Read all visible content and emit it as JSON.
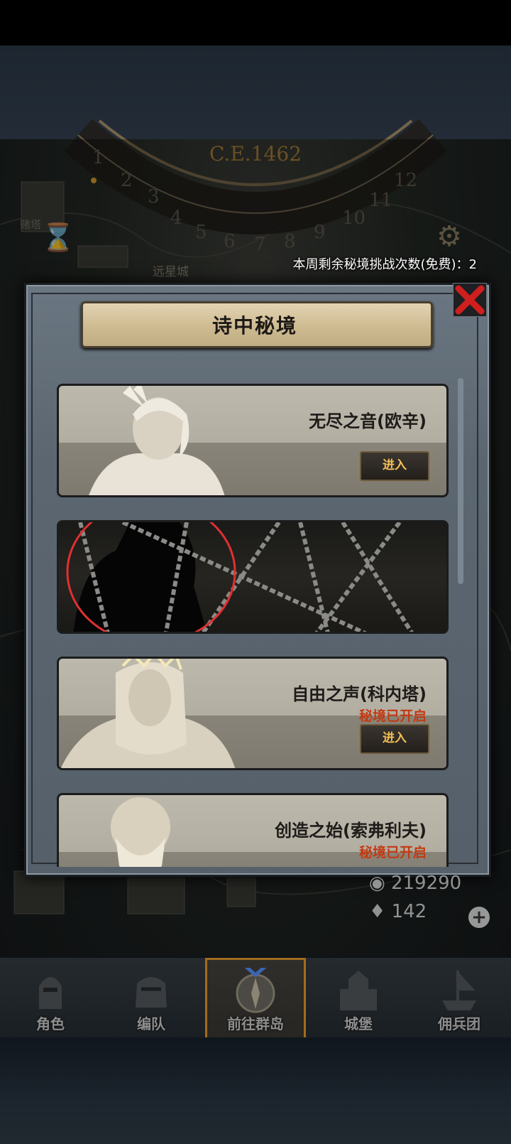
{
  "header": {
    "year": "C.E.1462",
    "weekly_challenges": "本周剩余秘境挑战次数(免费)：2"
  },
  "map_labels": {
    "city": "远星城",
    "left": "赌塔"
  },
  "panel": {
    "title": "诗中秘境",
    "cards": [
      {
        "name": "无尽之音(欧辛)",
        "status": "",
        "enter_label": "进入",
        "locked": false
      },
      {
        "name": "",
        "status": "",
        "enter_label": "",
        "locked": true
      },
      {
        "name": "自由之声(科内塔)",
        "status": "秘境已开启",
        "enter_label": "进入",
        "locked": false
      },
      {
        "name": "创造之始(索弗利夫)",
        "status": "秘境已开启",
        "enter_label": "",
        "locked": false
      }
    ]
  },
  "resources": {
    "coins": "219290",
    "gems": "142"
  },
  "nav": {
    "items": [
      {
        "label": "角色",
        "icon": "knight-helmet-icon"
      },
      {
        "label": "编队",
        "icon": "formation-helmet-icon"
      },
      {
        "label": "前往群岛",
        "icon": "compass-icon"
      },
      {
        "label": "城堡",
        "icon": "castle-icon"
      },
      {
        "label": "佣兵团",
        "icon": "ship-icon"
      }
    ],
    "active_index": 2
  },
  "colors": {
    "accent": "#f2bf55",
    "status_red": "#c23a12",
    "close_red": "#d01f1f",
    "annotation_red": "#e03030"
  }
}
